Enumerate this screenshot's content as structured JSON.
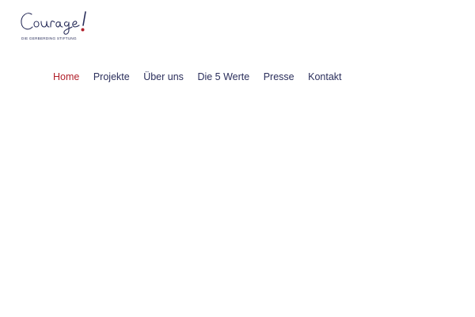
{
  "logo": {
    "wordmark": "Courage!",
    "tagline": "DIE GERBERDING STIFTUNG",
    "text_color": "#2a2f5b",
    "accent_color": "#b11f2a",
    "icon": "courage-logo"
  },
  "nav": {
    "items": [
      {
        "label": "Home",
        "active": true
      },
      {
        "label": "Projekte",
        "active": false
      },
      {
        "label": "Über uns",
        "active": false
      },
      {
        "label": "Die 5 Werte",
        "active": false
      },
      {
        "label": "Presse",
        "active": false
      },
      {
        "label": "Kontakt",
        "active": false
      }
    ],
    "text_color": "#2b2f5c",
    "active_color": "#b11f2a"
  }
}
